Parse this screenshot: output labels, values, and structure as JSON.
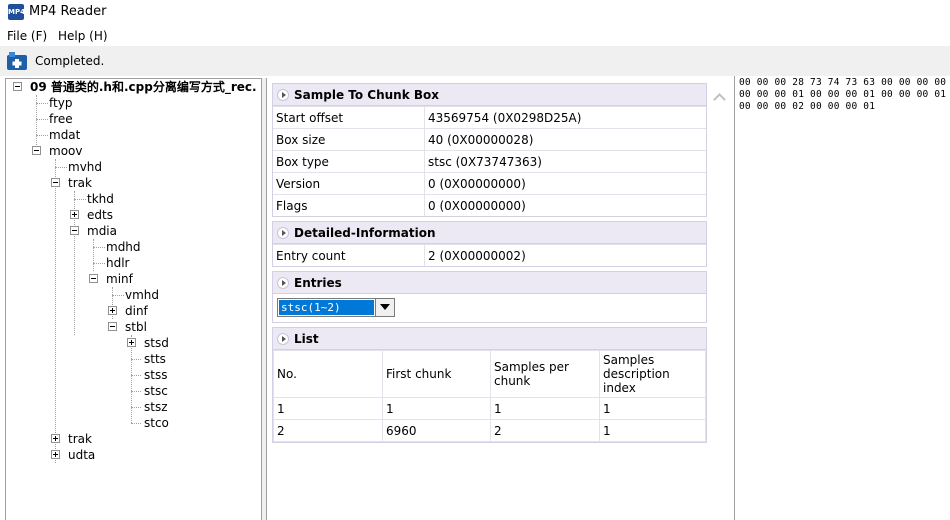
{
  "window": {
    "title": "MP4 Reader",
    "icon": "mp4-app-icon",
    "icon_text": "MP4"
  },
  "menu": {
    "file": "File (F)",
    "help": "Help (H)"
  },
  "status": {
    "icon": "status-app-icon",
    "text": "Completed."
  },
  "tree": {
    "root": "09 普通类的.h和.cpp分离编写方式_rec.",
    "n_ftyp": "ftyp",
    "n_free": "free",
    "n_mdat": "mdat",
    "n_moov": "moov",
    "n_mvhd": "mvhd",
    "n_trak1": "trak",
    "n_tkhd": "tkhd",
    "n_edts": "edts",
    "n_mdia": "mdia",
    "n_mdhd": "mdhd",
    "n_hdlr": "hdlr",
    "n_minf": "minf",
    "n_vmhd": "vmhd",
    "n_dinf": "dinf",
    "n_stbl": "stbl",
    "n_stsd": "stsd",
    "n_stts": "stts",
    "n_stss": "stss",
    "n_stsc": "stsc",
    "n_stsz": "stsz",
    "n_stco": "stco",
    "n_trak2": "trak",
    "n_udta": "udta"
  },
  "box_section": {
    "title": "Sample To Chunk Box",
    "rows": [
      {
        "key": "Start offset",
        "value": "43569754 (0X0298D25A)"
      },
      {
        "key": "Box size",
        "value": "40 (0X00000028)"
      },
      {
        "key": "Box type",
        "value": "stsc (0X73747363)"
      },
      {
        "key": "Version",
        "value": "0 (0X00000000)"
      },
      {
        "key": "Flags",
        "value": "0 (0X00000000)"
      }
    ]
  },
  "detail_section": {
    "title": "Detailed-Information",
    "rows": [
      {
        "key": "Entry count",
        "value": "2 (0X00000002)"
      }
    ]
  },
  "entries_section": {
    "title": "Entries",
    "selected": "stsc(1~2)"
  },
  "list_section": {
    "title": "List",
    "headers": [
      "No.",
      "First chunk",
      "Samples per chunk",
      "Samples description index"
    ],
    "rows": [
      [
        "1",
        "1",
        "1",
        "1"
      ],
      [
        "2",
        "6960",
        "2",
        "1"
      ]
    ]
  },
  "hex": {
    "lines": [
      "00 00 00 28 73 74 73 63 00 00 00 00",
      "00 00 00 01 00 00 00 01 00 00 00 01",
      "00 00 00 02 00 00 00 01"
    ]
  }
}
